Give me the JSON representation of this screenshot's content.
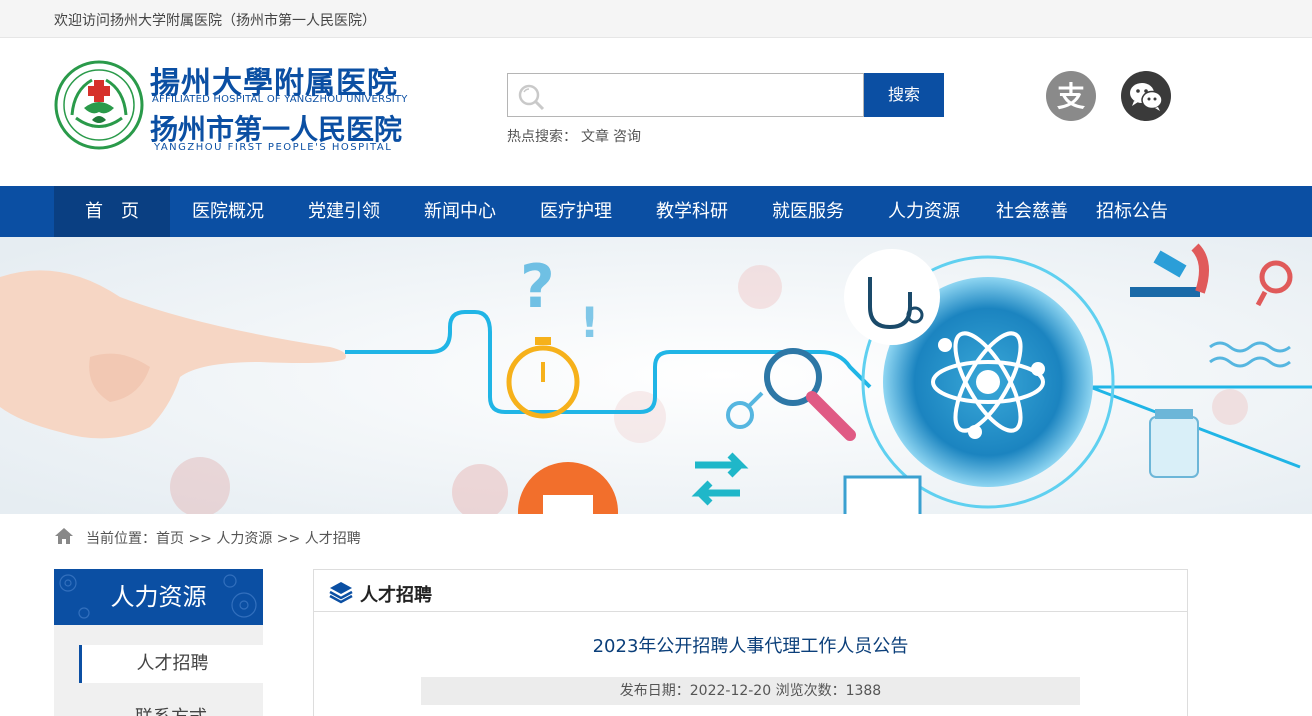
{
  "topbar": {
    "welcome": "欢迎访问扬州大学附属医院（扬州市第一人民医院）"
  },
  "logo": {
    "cn_line1": "揚州大學附属医院",
    "en_line1": "AFFILIATED HOSPITAL OF YANGZHOU UNIVERSITY",
    "cn_line2": "扬州市第一人民医院",
    "en_line2": "YANGZHOU FIRST PEOPLE'S HOSPITAL"
  },
  "search": {
    "placeholder": "",
    "button_label": "搜索",
    "hot_label": "热点搜索：",
    "hot_terms": [
      "文章",
      "咨询"
    ]
  },
  "social": {
    "alipay_icon": "alipay-icon",
    "wechat_icon": "wechat-icon"
  },
  "nav": {
    "items": [
      {
        "label": "首　页",
        "active": true
      },
      {
        "label": "医院概况"
      },
      {
        "label": "党建引领"
      },
      {
        "label": "新闻中心"
      },
      {
        "label": "医疗护理"
      },
      {
        "label": "教学科研"
      },
      {
        "label": "就医服务"
      },
      {
        "label": "人力资源"
      },
      {
        "label": "社会慈善"
      },
      {
        "label": "招标公告"
      }
    ]
  },
  "breadcrumb": {
    "text": "当前位置：首页 >> 人力资源 >> 人才招聘"
  },
  "sidebar": {
    "title": "人力资源",
    "items": [
      {
        "label": "人才招聘",
        "active": true
      },
      {
        "label": "联系方式"
      }
    ]
  },
  "content": {
    "section_title": "人才招聘",
    "article_title": "2023年公开招聘人事代理工作人员公告",
    "meta": "发布日期：2022-12-20 浏览次数：1388"
  },
  "colors": {
    "brand_blue": "#0b4fa3",
    "nav_active": "#0a3f82"
  }
}
